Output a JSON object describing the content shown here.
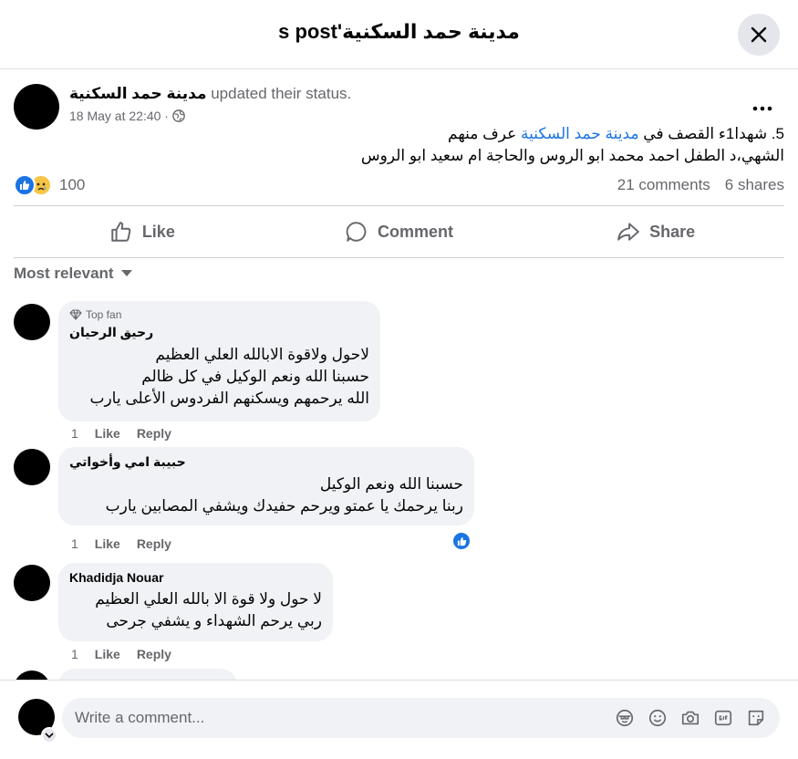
{
  "header": {
    "title": "s post'مدينة حمد السكنية"
  },
  "post": {
    "author": "مدينة حمد السكنية",
    "action": " updated their status.",
    "timestamp": "18 May at 22:40 ·",
    "body_line1_a": "5.  شهدا1ء القصف في ",
    "body_line1_link": "مدينة حمد السكنية",
    "body_line1_b": " عرف منهم",
    "body_line2": "الشهي،د الطفل احمد محمد ابو الروس والحاجة ام سعيد ابو الروس",
    "reaction_count": "100",
    "comments_count": "21 comments",
    "shares_count": "6 shares"
  },
  "actions": {
    "like": "Like",
    "comment": "Comment",
    "share": "Share"
  },
  "sort_label": "Most relevant",
  "comments": [
    {
      "badge": "Top fan",
      "name": "رحيق الرحيان",
      "lines": [
        "لاحول ولاقوة الابالله العلي العظيم",
        "حسبنا الله ونعم الوكيل في كل ظالم",
        "الله يرحمهم ويسكنهم الفردوس الأعلى يارب"
      ],
      "time": "1",
      "like": "Like",
      "reply": "Reply"
    },
    {
      "name": "حبيبة امي وأخواتي",
      "lines": [
        "حسبنا الله ونعم الوكيل",
        "ربنا يرحمك يا عمتو ويرحم حفيدك ويشفي المصابين يارب"
      ],
      "time": "1",
      "like": "Like",
      "reply": "Reply"
    },
    {
      "name": "Khadidja Nouar",
      "lines": [
        "لا حول ولا قوة الا بالله العلي العظيم",
        "ربي يرحم الشهداء و يشفي جرحى"
      ],
      "time": "1",
      "like": "Like",
      "reply": "Reply"
    }
  ],
  "composer": {
    "placeholder": "Write a comment..."
  },
  "colors": {
    "accent": "#1b74e4",
    "bubble": "#f0f2f5",
    "secondary_text": "#65676b"
  }
}
